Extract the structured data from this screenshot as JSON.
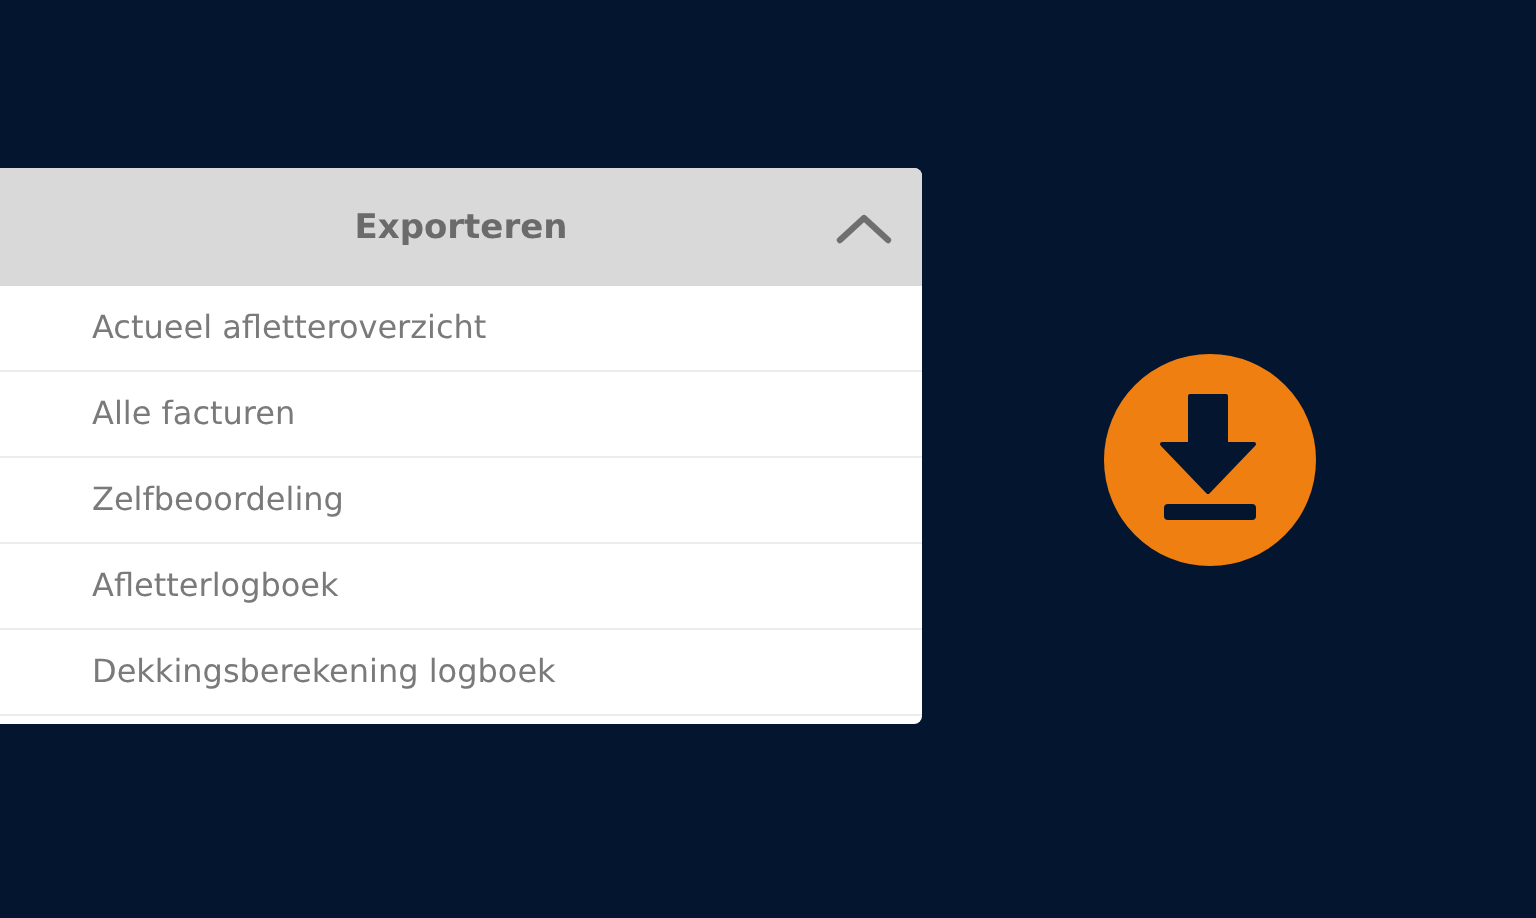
{
  "export_panel": {
    "title": "Exporteren",
    "expanded": true,
    "items": [
      {
        "label": "Actueel afletteroverzicht"
      },
      {
        "label": "Alle facturen"
      },
      {
        "label": "Zelfbeoordeling"
      },
      {
        "label": "Afletterlogboek"
      },
      {
        "label": "Dekkingsberekening logboek"
      }
    ]
  }
}
